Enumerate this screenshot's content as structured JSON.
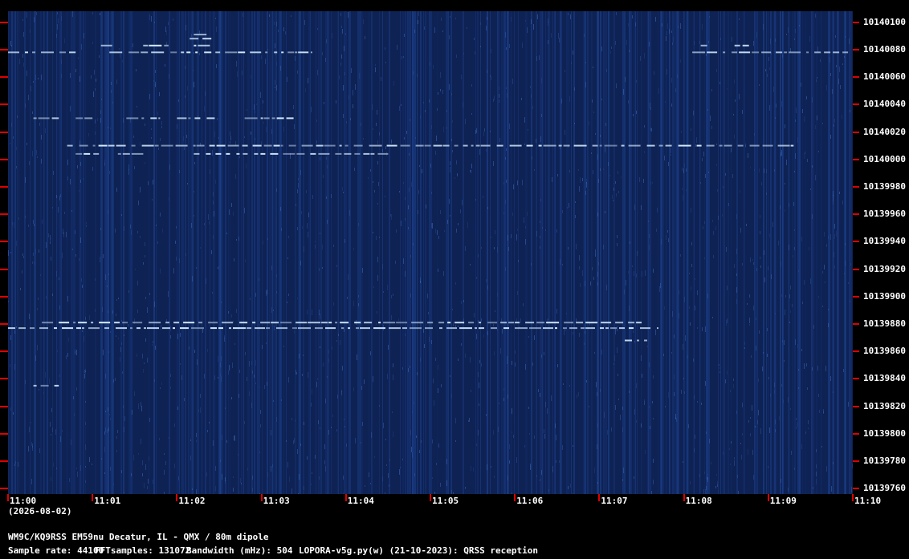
{
  "chart_data": {
    "type": "heatmap",
    "title": "",
    "xlabel": "",
    "ylabel": "",
    "x_ticks": [
      "11:00",
      "11:01",
      "11:02",
      "11:03",
      "11:04",
      "11:05",
      "11:06",
      "11:07",
      "11:08",
      "11:09",
      "11:10"
    ],
    "y_ticks": [
      "10140100",
      "10140080",
      "10140060",
      "10140040",
      "10140020",
      "10140000",
      "10139980",
      "10139960",
      "10139940",
      "10139920",
      "10139900",
      "10139880",
      "10139860",
      "10139840",
      "10139820",
      "10139800",
      "10139780",
      "10139760"
    ],
    "ylim": [
      10139756,
      10140108
    ],
    "x_range_minutes": [
      0,
      10
    ],
    "grid": false,
    "colors": {
      "background": "#0e2254",
      "noise": "#1c3f8a",
      "signal": "#d6ecff",
      "ticks": "#e00000"
    },
    "traces": [
      {
        "freq": 10140078,
        "segments": [
          [
            0.0,
            0.8
          ],
          [
            1.2,
            3.6
          ],
          [
            8.1,
            10.0
          ]
        ]
      },
      {
        "freq": 10140083,
        "segments": [
          [
            1.1,
            1.3
          ],
          [
            1.6,
            1.9
          ],
          [
            2.2,
            2.4
          ],
          [
            8.2,
            8.3
          ],
          [
            8.6,
            8.8
          ]
        ]
      },
      {
        "freq": 10140088,
        "segments": [
          [
            2.15,
            2.45
          ]
        ]
      },
      {
        "freq": 10140091,
        "segments": [
          [
            2.2,
            2.35
          ]
        ]
      },
      {
        "freq": 10140030,
        "segments": [
          [
            0.3,
            0.6
          ],
          [
            0.8,
            1.0
          ],
          [
            1.4,
            1.8
          ],
          [
            2.0,
            2.5
          ],
          [
            2.8,
            3.4
          ]
        ]
      },
      {
        "freq": 10140010,
        "segments": [
          [
            0.7,
            9.3
          ]
        ]
      },
      {
        "freq": 10140004,
        "segments": [
          [
            0.8,
            1.1
          ],
          [
            1.3,
            1.6
          ],
          [
            2.2,
            4.5
          ]
        ]
      },
      {
        "freq": 10139877,
        "segments": [
          [
            0.0,
            7.7
          ]
        ]
      },
      {
        "freq": 10139881,
        "segments": [
          [
            0.4,
            7.5
          ]
        ]
      },
      {
        "freq": 10139868,
        "segments": [
          [
            7.3,
            7.6
          ]
        ]
      },
      {
        "freq": 10139835,
        "segments": [
          [
            0.3,
            0.6
          ]
        ]
      }
    ]
  },
  "date_label": "(2026-08-02)",
  "footer": {
    "station": "WM9C/KQ9RSS EM59nu Decatur, IL - QMX / 80m dipole",
    "sample_rate": "Sample rate: 44100",
    "fft_samples": "FFTsamples: 131072",
    "bandwidth": "Bandwidth (mHz): 504",
    "software": "LOPORA-v5g.py(w) (21-10-2023): QRSS reception"
  }
}
